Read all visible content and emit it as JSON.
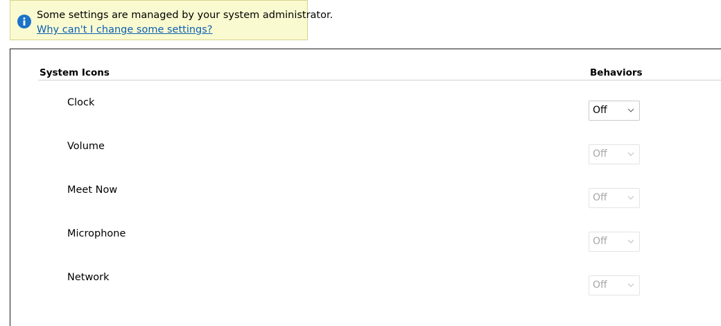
{
  "banner": {
    "message": "Some settings are managed by your system administrator.",
    "link": "Why can't I change some settings?",
    "icon": "info-icon",
    "icon_color": "#1a73c9"
  },
  "table": {
    "header_name": "System Icons",
    "header_behaviors": "Behaviors",
    "rows": [
      {
        "label": "Clock",
        "value": "Off",
        "enabled": true
      },
      {
        "label": "Volume",
        "value": "Off",
        "enabled": false
      },
      {
        "label": "Meet Now",
        "value": "Off",
        "enabled": false
      },
      {
        "label": "Microphone",
        "value": "Off",
        "enabled": false
      },
      {
        "label": "Network",
        "value": "Off",
        "enabled": false
      }
    ]
  }
}
